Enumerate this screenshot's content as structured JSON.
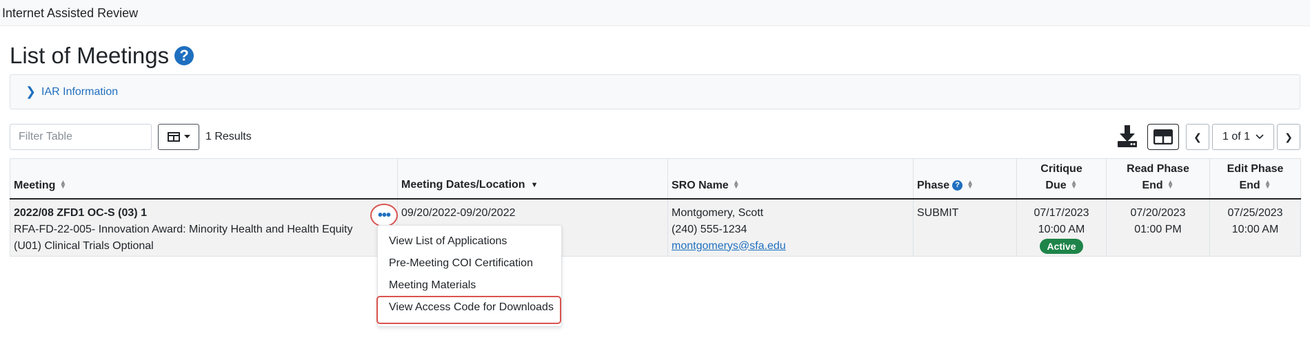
{
  "app": {
    "title": "Internet Assisted Review"
  },
  "page": {
    "title": "List of Meetings",
    "help_icon": "question-circle-icon"
  },
  "info_panel": {
    "label": "IAR Information"
  },
  "toolbar": {
    "filter_placeholder": "Filter Table",
    "results_text": "1 Results",
    "pagination": {
      "current": "1 of 1"
    }
  },
  "table": {
    "columns": {
      "meeting": "Meeting",
      "dates": "Meeting Dates/Location",
      "sro": "SRO Name",
      "phase": "Phase",
      "critique_1": "Critique",
      "critique_2": "Due",
      "read_1": "Read Phase",
      "read_2": "End",
      "edit_1": "Edit Phase",
      "edit_2": "End"
    },
    "rows": [
      {
        "meeting_name": "2022/08 ZFD1 OC-S (03) 1",
        "meeting_desc_1": "RFA-FD-22-005- Innovation Award: Minority Health and Health Equity",
        "meeting_desc_2": "(U01) Clinical Trials Optional",
        "dates": "09/20/2022-09/20/2022",
        "sro_name": "Montgomery, Scott",
        "sro_phone": "(240) 555-1234",
        "sro_email": "montgomerys@sfa.edu",
        "phase": "SUBMIT",
        "critique_date": "07/17/2023",
        "critique_time": "10:00 AM",
        "status_badge": "Active",
        "read_date": "07/20/2023",
        "read_time": "01:00 PM",
        "edit_date": "07/25/2023",
        "edit_time": "10:00 AM"
      }
    ]
  },
  "actions_menu": {
    "items": [
      "View List of Applications",
      "Pre-Meeting COI Certification",
      "Meeting Materials",
      "View Access Code for Downloads"
    ]
  },
  "colors": {
    "accent": "#1f6fbf",
    "highlight": "#d9534f",
    "active": "#1e8449"
  }
}
